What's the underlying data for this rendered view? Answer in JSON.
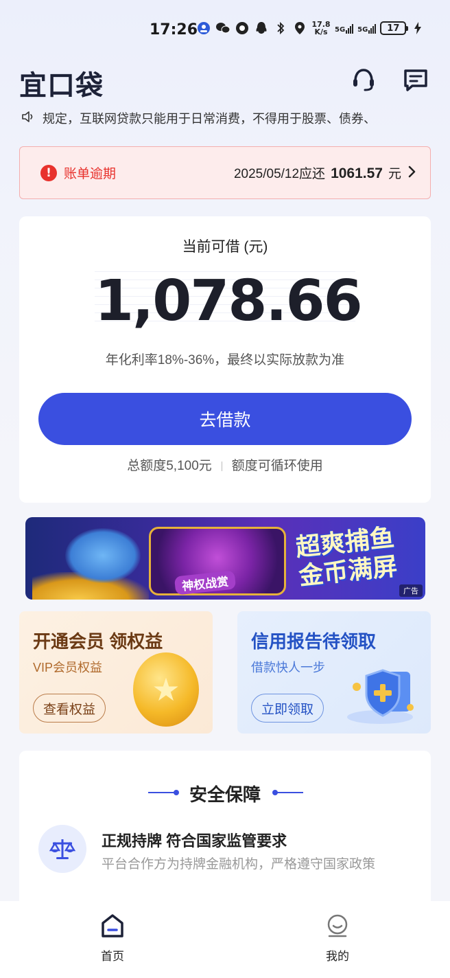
{
  "status_bar": {
    "time": "17:26",
    "net_speed_value": "17.8",
    "net_speed_unit": "K/s",
    "sim1": "5G",
    "sim2": "5G",
    "battery": "17"
  },
  "header": {
    "logo": "宜口袋",
    "icons": [
      "headset-icon",
      "message-icon"
    ]
  },
  "notice": {
    "text": "规定，互联网贷款只能用于日常消费，不得用于股票、债券、"
  },
  "overdue": {
    "label": "账单逾期",
    "due_text": "2025/05/12应还",
    "amount": "1061.57",
    "unit": "元",
    "color": "#e8322d"
  },
  "loan_card": {
    "title": "当前可借 (元)",
    "amount": "1,078.66",
    "rate_text": "年化利率18%-36%，最终以实际放款为准",
    "button_label": "去借款",
    "total_quota": "总额度5,100元",
    "quota_note": "额度可循环使用",
    "accent": "#3a4fe0"
  },
  "ad": {
    "wheel_text": "神权战赏",
    "headline": "超爽捕鱼 金币满屏",
    "tag": "广告"
  },
  "promos": {
    "vip": {
      "title": "开通会员 领权益",
      "subtitle": "VIP会员权益",
      "button": "查看权益"
    },
    "credit": {
      "title": "信用报告待领取",
      "subtitle": "借款快人一步",
      "button": "立即领取"
    }
  },
  "security": {
    "title": "安全保障",
    "item_title": "正规持牌 符合国家监管要求",
    "item_desc": "平台合作方为持牌金融机构，严格遵守国家政策"
  },
  "nav": {
    "home": "首页",
    "mine": "我的"
  }
}
